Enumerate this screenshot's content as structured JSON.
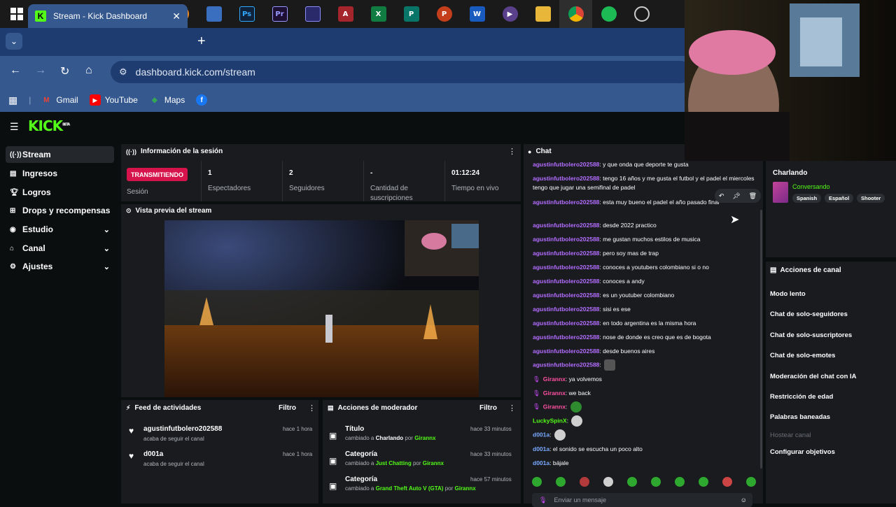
{
  "taskbar": {
    "icons": [
      "windows-icon",
      "search-icon",
      "netflix-icon",
      "after-effects-icon",
      "player-icon",
      "fl-studio-icon",
      "window-icon",
      "photoshop-icon",
      "premiere-icon",
      "capture-icon",
      "access-icon",
      "excel-icon",
      "publisher-icon",
      "powerpoint-icon",
      "word-icon",
      "media-player-icon",
      "file-explorer-icon",
      "chrome-icon",
      "spotify-icon",
      "recorder-icon"
    ]
  },
  "browser": {
    "tab_title": "Stream - Kick Dashboard",
    "url": "dashboard.kick.com/stream",
    "bookmarks": [
      {
        "label": "Gmail",
        "icon": "gmail-icon"
      },
      {
        "label": "YouTube",
        "icon": "youtube-icon"
      },
      {
        "label": "Maps",
        "icon": "maps-icon"
      }
    ]
  },
  "kick": {
    "logo": "KICK",
    "logo_badge": "BETA"
  },
  "sidebar": {
    "items": [
      {
        "label": "Stream",
        "icon": "stream-icon",
        "active": true
      },
      {
        "label": "Ingresos",
        "icon": "income-icon"
      },
      {
        "label": "Logros",
        "icon": "trophy-icon"
      },
      {
        "label": "Drops y recompensas",
        "icon": "drops-icon"
      },
      {
        "label": "Estudio",
        "icon": "studio-icon",
        "expandable": true
      },
      {
        "label": "Canal",
        "icon": "channel-icon",
        "expandable": true
      },
      {
        "label": "Ajustes",
        "icon": "settings-icon",
        "expandable": true
      }
    ]
  },
  "session": {
    "title": "Información de la sesión",
    "live_badge": "TRANSMITIENDO",
    "status_label": "Sesión",
    "stats": [
      {
        "value": "1",
        "label": "Espectadores"
      },
      {
        "value": "2",
        "label": "Seguidores"
      },
      {
        "value": "-",
        "label": "Cantidad de suscripciones"
      },
      {
        "value": "01:12:24",
        "label": "Tiempo en vivo"
      }
    ]
  },
  "preview": {
    "title": "Vista previa del stream"
  },
  "feed": {
    "title": "Feed de actividades",
    "filter": "Filtro",
    "items": [
      {
        "user": "agustinfutbolero202588",
        "sub": "acaba de seguir el canal",
        "time": "hace 1 hora"
      },
      {
        "user": "d001a",
        "sub": "acaba de seguir el canal",
        "time": "hace 1 hora"
      }
    ]
  },
  "mod": {
    "title": "Acciones de moderador",
    "filter": "Filtro",
    "items": [
      {
        "title": "Título",
        "pre": "cambiado a",
        "value": "Charlando",
        "by": "por",
        "user": "Girannx",
        "time": "hace 33 minutos"
      },
      {
        "title": "Categoría",
        "pre": "cambiado a",
        "value": "Just Chatting",
        "by": "por",
        "user": "Girannx",
        "time": "hace 33 minutos"
      },
      {
        "title": "Categoría",
        "pre": "cambiado a",
        "value": "Grand Theft Auto V (GTA)",
        "by": "por",
        "user": "Girannx",
        "time": "hace 57 minutos"
      }
    ]
  },
  "chat": {
    "title": "Chat",
    "input_placeholder": "Enviar un mensaje",
    "messages": [
      {
        "user": "agustinfutbolero202588",
        "text": "y que onda que deporte te gusta"
      },
      {
        "user": "agustinfutbolero202588",
        "text": "tengo 16 años y me gusta el futbol y el padel el miercoles tengo que jugar una semifinal de padel"
      },
      {
        "user": "agustinfutbolero202588",
        "text": "esta muy bueno el padel el año pasado final"
      },
      {
        "user": "agustinfutbolero202588",
        "text": "desde 2022 practico"
      },
      {
        "user": "agustinfutbolero202588",
        "text": "me gustan muchos estilos de musica"
      },
      {
        "user": "agustinfutbolero202588",
        "text": "pero soy mas de trap"
      },
      {
        "user": "agustinfutbolero202588",
        "text": "conoces a youtubers colombiano si o no"
      },
      {
        "user": "agustinfutbolero202588",
        "text": "conoces a andy"
      },
      {
        "user": "agustinfutbolero202588",
        "text": "es un youtuber colombiano"
      },
      {
        "user": "agustinfutbolero202588",
        "text": "sisi es ese"
      },
      {
        "user": "agustinfutbolero202588",
        "text": "en todo argentina es la misma hora"
      },
      {
        "user": "agustinfutbolero202588",
        "text": "nose de donde es creo que es de bogota"
      },
      {
        "user": "agustinfutbolero202588",
        "text": "desde buenos aires"
      },
      {
        "user": "agustinfutbolero202588",
        "text": ""
      },
      {
        "user": "Girannx",
        "text": "ya volvemos"
      },
      {
        "user": "Girannx",
        "text": "we back"
      },
      {
        "user": "Girannx",
        "text": ""
      },
      {
        "user": "LuckySpinX",
        "text": ""
      },
      {
        "user": "d001a",
        "text": ""
      },
      {
        "user": "d001a",
        "text": "el sonido se escucha un poco alto"
      },
      {
        "user": "d001a",
        "text": "bájale"
      }
    ]
  },
  "stream_info": {
    "title": "Charlando",
    "category": "Conversando",
    "tags": [
      "Spanish",
      "Español",
      "Shooter"
    ]
  },
  "channel_actions": {
    "title": "Acciones de canal",
    "items": [
      {
        "label": "Modo lento"
      },
      {
        "label": "Chat de solo-seguidores"
      },
      {
        "label": "Chat de solo-suscriptores"
      },
      {
        "label": "Chat de solo-emotes"
      },
      {
        "label": "Moderación del chat con IA"
      },
      {
        "label": "Restricción de edad"
      },
      {
        "label": "Palabras baneadas"
      },
      {
        "label": "Hostear canal",
        "disabled": true
      },
      {
        "label": "Configurar objetivos"
      }
    ]
  },
  "colors": {
    "kick_green": "#53fc18",
    "live_red": "#d6134b",
    "chat_purple": "#b36dff",
    "panel_bg": "#191b1f",
    "page_bg": "#0b0e0f",
    "chrome_blue": "#35588f"
  }
}
